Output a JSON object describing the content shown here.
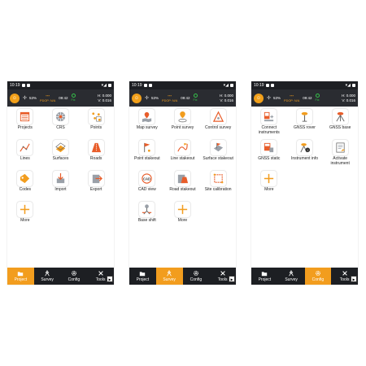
{
  "colors": {
    "accent": "#f29d1e",
    "bar": "#1d1f23",
    "fix": "#36c24a"
  },
  "status": {
    "time": "10:19",
    "pct": "53%",
    "pdop_value": "---",
    "pdop_label": "PDOP: N/A",
    "clock": "09:42",
    "fix_label": "Fix",
    "h_value": "H: 0.000",
    "v_value": "V: 0.016"
  },
  "tabs": {
    "project": "Project",
    "survey": "Survey",
    "config": "Config",
    "tools": "Tools"
  },
  "screens": [
    {
      "active_tab": "project",
      "items": [
        {
          "label": "Projects",
          "icon": "projects-icon"
        },
        {
          "label": "CRS",
          "icon": "crs-icon"
        },
        {
          "label": "Points",
          "icon": "points-icon"
        },
        {
          "label": "Lines",
          "icon": "lines-icon"
        },
        {
          "label": "Surfaces",
          "icon": "surfaces-icon"
        },
        {
          "label": "Roads",
          "icon": "roads-icon"
        },
        {
          "label": "Codes",
          "icon": "codes-icon"
        },
        {
          "label": "Import",
          "icon": "import-icon"
        },
        {
          "label": "Export",
          "icon": "export-icon"
        },
        {
          "label": "More",
          "icon": "plus-icon"
        }
      ]
    },
    {
      "active_tab": "survey",
      "items": [
        {
          "label": "Map survey",
          "icon": "map-survey-icon"
        },
        {
          "label": "Point survey",
          "icon": "point-survey-icon"
        },
        {
          "label": "Control survey",
          "icon": "control-survey-icon"
        },
        {
          "label": "Point stakeout",
          "icon": "point-stakeout-icon"
        },
        {
          "label": "Line stakeout",
          "icon": "line-stakeout-icon"
        },
        {
          "label": "Surface stakeout",
          "icon": "surface-stakeout-icon"
        },
        {
          "label": "CAD view",
          "icon": "cad-view-icon"
        },
        {
          "label": "Road stakeout",
          "icon": "road-stakeout-icon"
        },
        {
          "label": "Site calibration",
          "icon": "site-calibration-icon"
        },
        {
          "label": "Base shift",
          "icon": "base-shift-icon"
        },
        {
          "label": "More",
          "icon": "plus-icon"
        }
      ]
    },
    {
      "active_tab": "config",
      "items": [
        {
          "label": "Connect instruments",
          "icon": "connect-instruments-icon"
        },
        {
          "label": "GNSS rover",
          "icon": "gnss-rover-icon"
        },
        {
          "label": "GNSS base",
          "icon": "gnss-base-icon"
        },
        {
          "label": "GNSS static",
          "icon": "gnss-static-icon"
        },
        {
          "label": "Instrument info",
          "icon": "instrument-info-icon"
        },
        {
          "label": "Activate instrument",
          "icon": "activate-instrument-icon"
        },
        {
          "label": "More",
          "icon": "plus-icon"
        }
      ]
    }
  ]
}
